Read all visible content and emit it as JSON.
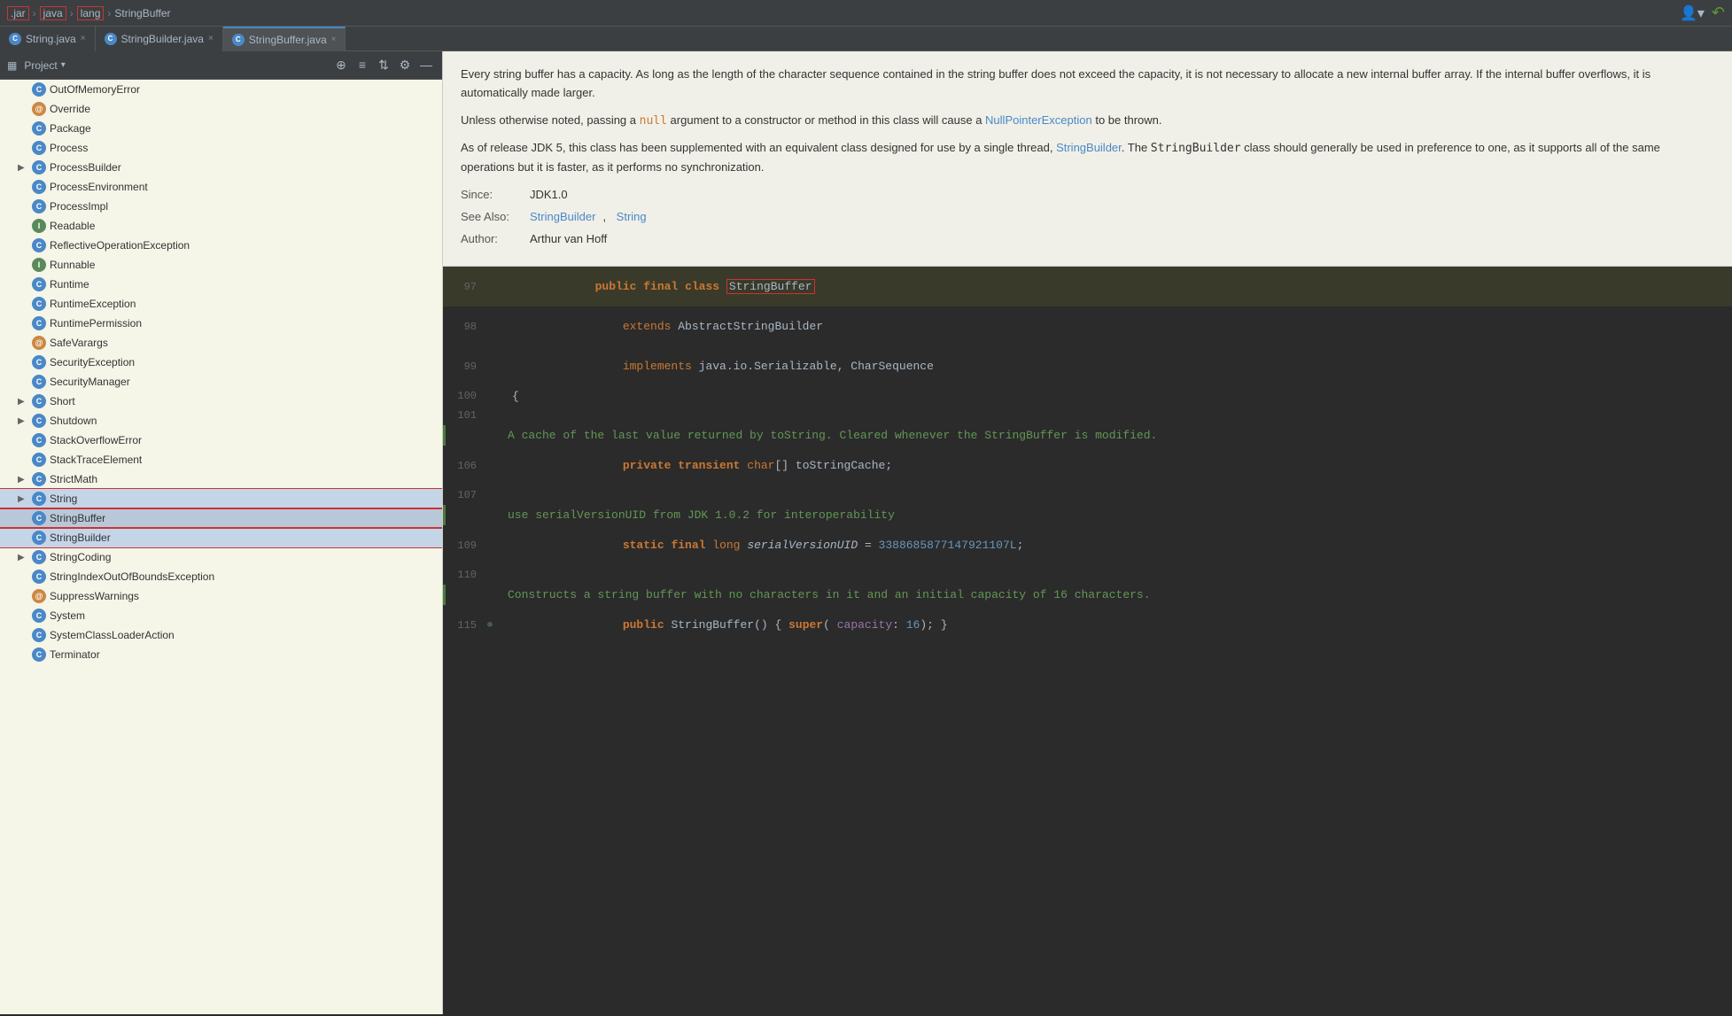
{
  "topbar": {
    "breadcrumb": {
      "file": ".jar",
      "path1": "java",
      "path2": "lang",
      "current": "StringBuffer"
    },
    "right_icon1": "👤",
    "right_icon2": "↶"
  },
  "tabs": [
    {
      "id": "string-java",
      "label": "String.java",
      "active": false,
      "icon": "C"
    },
    {
      "id": "stringbuilder-java",
      "label": "StringBuilder.java",
      "active": false,
      "icon": "C"
    },
    {
      "id": "stringbuffer-java",
      "label": "StringBuffer.java",
      "active": true,
      "icon": "C"
    }
  ],
  "sidebar": {
    "title": "Project",
    "items": [
      {
        "id": "OutOfMemoryError",
        "label": "OutOfMemoryError",
        "type": "C",
        "indent": 1,
        "expandable": false
      },
      {
        "id": "Override",
        "label": "Override",
        "type": "A",
        "indent": 1,
        "expandable": false
      },
      {
        "id": "Package",
        "label": "Package",
        "type": "C",
        "indent": 1,
        "expandable": false
      },
      {
        "id": "Process",
        "label": "Process",
        "type": "C",
        "indent": 1,
        "expandable": false
      },
      {
        "id": "ProcessBuilder",
        "label": "ProcessBuilder",
        "type": "C",
        "indent": 1,
        "expandable": true
      },
      {
        "id": "ProcessEnvironment",
        "label": "ProcessEnvironment",
        "type": "C",
        "indent": 1,
        "expandable": false
      },
      {
        "id": "ProcessImpl",
        "label": "ProcessImpl",
        "type": "C",
        "indent": 1,
        "expandable": false
      },
      {
        "id": "Readable",
        "label": "Readable",
        "type": "I",
        "indent": 1,
        "expandable": false
      },
      {
        "id": "ReflectiveOperationException",
        "label": "ReflectiveOperationException",
        "type": "C",
        "indent": 1,
        "expandable": false
      },
      {
        "id": "Runnable",
        "label": "Runnable",
        "type": "I",
        "indent": 1,
        "expandable": false
      },
      {
        "id": "Runtime",
        "label": "Runtime",
        "type": "C",
        "indent": 1,
        "expandable": false
      },
      {
        "id": "RuntimeException",
        "label": "RuntimeException",
        "type": "C",
        "indent": 1,
        "expandable": false
      },
      {
        "id": "RuntimePermission",
        "label": "RuntimePermission",
        "type": "C",
        "indent": 1,
        "expandable": false
      },
      {
        "id": "SafeVarargs",
        "label": "SafeVarargs",
        "type": "A",
        "indent": 1,
        "expandable": false
      },
      {
        "id": "SecurityException",
        "label": "SecurityException",
        "type": "C",
        "indent": 1,
        "expandable": false
      },
      {
        "id": "SecurityManager",
        "label": "SecurityManager",
        "type": "C",
        "indent": 1,
        "expandable": false
      },
      {
        "id": "Short",
        "label": "Short",
        "type": "C",
        "indent": 1,
        "expandable": true
      },
      {
        "id": "Shutdown",
        "label": "Shutdown",
        "type": "C",
        "indent": 1,
        "expandable": true
      },
      {
        "id": "StackOverflowError",
        "label": "StackOverflowError",
        "type": "C",
        "indent": 1,
        "expandable": false
      },
      {
        "id": "StackTraceElement",
        "label": "StackTraceElement",
        "type": "C",
        "indent": 1,
        "expandable": false
      },
      {
        "id": "StrictMath",
        "label": "StrictMath",
        "type": "C",
        "indent": 1,
        "expandable": true
      },
      {
        "id": "String",
        "label": "String",
        "type": "C",
        "indent": 1,
        "expandable": true,
        "selected": true
      },
      {
        "id": "StringBuffer",
        "label": "StringBuffer",
        "type": "C",
        "indent": 1,
        "expandable": false,
        "current": true
      },
      {
        "id": "StringBuilder",
        "label": "StringBuilder",
        "type": "C",
        "indent": 1,
        "expandable": false,
        "selected": true
      },
      {
        "id": "StringCoding",
        "label": "StringCoding",
        "type": "C",
        "indent": 1,
        "expandable": true
      },
      {
        "id": "StringIndexOutOfBoundsException",
        "label": "StringIndexOutOfBoundsException",
        "type": "C",
        "indent": 1,
        "expandable": false
      },
      {
        "id": "SuppressWarnings",
        "label": "SuppressWarnings",
        "type": "A",
        "indent": 1,
        "expandable": false
      },
      {
        "id": "System",
        "label": "System",
        "type": "C",
        "indent": 1,
        "expandable": false
      },
      {
        "id": "SystemClassLoaderAction",
        "label": "SystemClassLoaderAction",
        "type": "C",
        "indent": 1,
        "expandable": false
      },
      {
        "id": "Terminator",
        "label": "Terminator",
        "type": "C",
        "indent": 1,
        "expandable": false
      }
    ]
  },
  "doc": {
    "p1": "Every string buffer has a capacity. As long as the length of the character sequence contained in the string buffer does not exceed the capacity, it is not necessary to allocate a new internal buffer array. If the internal buffer overflows, it is automatically made larger.",
    "p2_prefix": "Unless otherwise noted, passing a ",
    "p2_null": "null",
    "p2_mid": " argument to a constructor or method in this class will cause a ",
    "p2_link": "NullPointerException",
    "p2_suffix": " to be thrown.",
    "p3_prefix": "As of release JDK 5, this class has been supplemented with an equivalent class designed for use by a single thread, ",
    "p3_link": "StringBuilder",
    "p3_mid": ". The ",
    "p3_code": "StringBuilder",
    "p3_suffix": " class should generally be used in preference to one, as it supports all of the same operations but it is faster, as it performs no synchronization.",
    "since_label": "Since:",
    "since_val": "JDK1.0",
    "seealso_label": "See Also:",
    "seealso_link1": "StringBuilder",
    "seealso_link2": "String",
    "author_label": "Author:",
    "author_val": "Arthur van Hoff"
  },
  "code": {
    "lines": [
      {
        "num": 97,
        "content": "public final class StringBuffer",
        "highlight": true
      },
      {
        "num": 98,
        "content": "    extends AbstractStringBuilder"
      },
      {
        "num": 99,
        "content": "    implements java.io.Serializable, CharSequence"
      },
      {
        "num": 100,
        "content": "{"
      },
      {
        "num": 101,
        "content": ""
      },
      {
        "num": 106,
        "content": "    private transient char[] toStringCache;"
      },
      {
        "num": 107,
        "content": ""
      },
      {
        "num": 109,
        "content": "    static final long serialVersionUID = 3388685877147921107L;"
      },
      {
        "num": 110,
        "content": ""
      },
      {
        "num": 115,
        "content": "    public StringBuffer() { super( capacity: 16); }"
      }
    ],
    "comment1": "A cache of the last value returned by toString. Cleared whenever the StringBuffer is modified.",
    "comment2": "use serialVersionUID from JDK 1.0.2 for interoperability",
    "comment3": "Constructs a string buffer with no characters in it and an initial capacity of 16 characters."
  }
}
